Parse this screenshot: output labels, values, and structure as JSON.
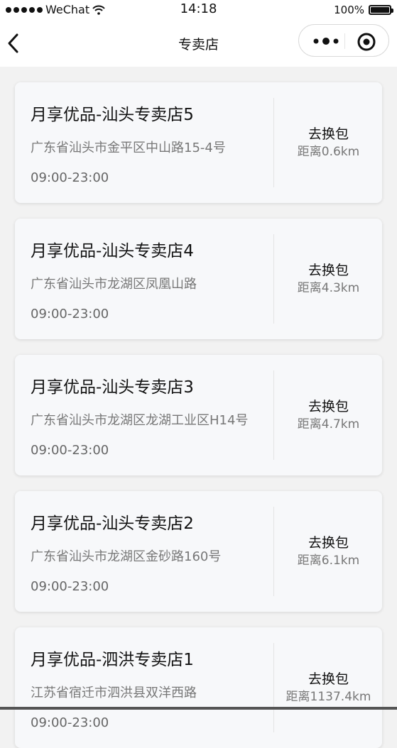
{
  "status_bar": {
    "carrier": "WeChat",
    "time": "14:18",
    "battery": "100%"
  },
  "nav": {
    "title": "专卖店",
    "icons": {
      "back": "chevron-left-icon",
      "more": "more-dots-icon",
      "close": "target-close-icon"
    }
  },
  "stores": [
    {
      "name": "月享优品-汕头专卖店5",
      "address": "广东省汕头市金平区中山路15-4号",
      "hours": "09:00-23:00",
      "action": "去换包",
      "distance": "距离0.6km"
    },
    {
      "name": "月享优品-汕头专卖店4",
      "address": "广东省汕头市龙湖区凤凰山路",
      "hours": "09:00-23:00",
      "action": "去换包",
      "distance": "距离4.3km"
    },
    {
      "name": "月享优品-汕头专卖店3",
      "address": "广东省汕头市龙湖区龙湖工业区H14号",
      "hours": "09:00-23:00",
      "action": "去换包",
      "distance": "距离4.7km"
    },
    {
      "name": "月享优品-汕头专卖店2",
      "address": "广东省汕头市龙湖区金砂路160号",
      "hours": "09:00-23:00",
      "action": "去换包",
      "distance": "距离6.1km"
    },
    {
      "name": "月享优品-泗洪专卖店1",
      "address": "江苏省宿迁市泗洪县双洋西路",
      "hours": "09:00-23:00",
      "action": "去换包",
      "distance": "距离1137.4km"
    }
  ],
  "colors": {
    "page_background": "#f2f2f2",
    "card_background": "#f7f8fa"
  }
}
